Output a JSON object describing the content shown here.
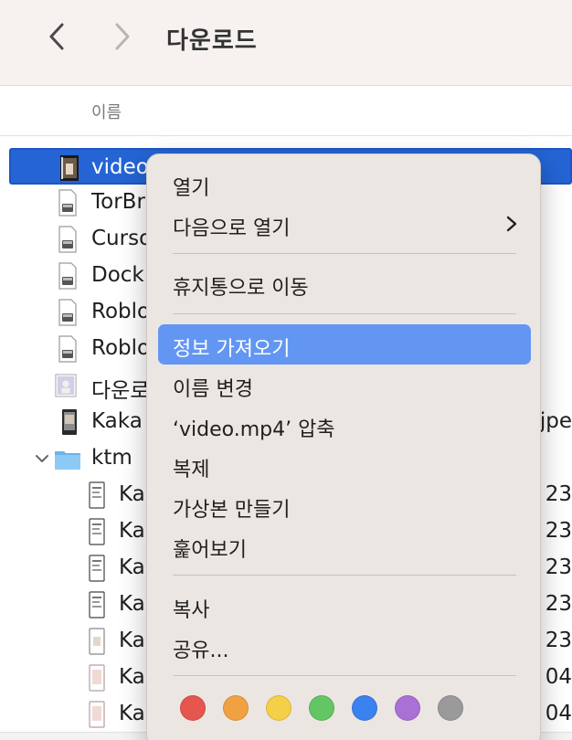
{
  "window": {
    "title": "다운로드"
  },
  "column_header": {
    "name": "이름"
  },
  "files": [
    {
      "name": "video",
      "suffix": "",
      "kind": "video-thumbnail",
      "selected": true
    },
    {
      "name": "TorBr",
      "suffix": "",
      "kind": "installer-disk-image"
    },
    {
      "name": "Curso",
      "suffix": "",
      "kind": "installer-disk-image"
    },
    {
      "name": "Dock",
      "suffix": "",
      "kind": "installer-disk-image"
    },
    {
      "name": "Roblo",
      "suffix": "",
      "kind": "installer-disk-image"
    },
    {
      "name": "Roblo",
      "suffix": "",
      "kind": "installer-disk-image"
    },
    {
      "name": "다운로",
      "suffix": "",
      "kind": "image-thumbnail"
    },
    {
      "name": "Kaka",
      "suffix": ".jpe",
      "kind": "phone-screenshot"
    },
    {
      "name": "ktm",
      "suffix": "",
      "kind": "folder",
      "expanded": true
    },
    {
      "name": "Ka",
      "suffix": "23",
      "kind": "phone-screenshot"
    },
    {
      "name": "Ka",
      "suffix": "23",
      "kind": "phone-screenshot"
    },
    {
      "name": "Ka",
      "suffix": "23",
      "kind": "phone-screenshot"
    },
    {
      "name": "Ka",
      "suffix": "23",
      "kind": "phone-screenshot"
    },
    {
      "name": "Ka",
      "suffix": "23",
      "kind": "phone-screenshot"
    },
    {
      "name": "Ka",
      "suffix": "04",
      "kind": "phone-screenshot"
    },
    {
      "name": "Ka",
      "suffix": "04",
      "kind": "phone-screenshot"
    }
  ],
  "context_menu": {
    "items": {
      "open": "열기",
      "open_with": "다음으로 열기",
      "move_to_trash": "휴지통으로 이동",
      "get_info": "정보 가져오기",
      "rename": "이름 변경",
      "compress": "‘video.mp4’ 압축",
      "duplicate": "복제",
      "make_alias": "가상본 만들기",
      "quick_look": "훑어보기",
      "copy": "복사",
      "share": "공유..."
    },
    "highlighted": "get_info",
    "tag_colors": [
      "#e5564f",
      "#f0a243",
      "#f4cf48",
      "#64c565",
      "#3b82f0",
      "#a970d6",
      "#9a9a9c"
    ]
  },
  "colors": {
    "selection": "#2464d4",
    "menu_highlight": "#6396f2",
    "toolbar_bg": "#f7f2ef",
    "menu_bg": "#ece6e2"
  }
}
